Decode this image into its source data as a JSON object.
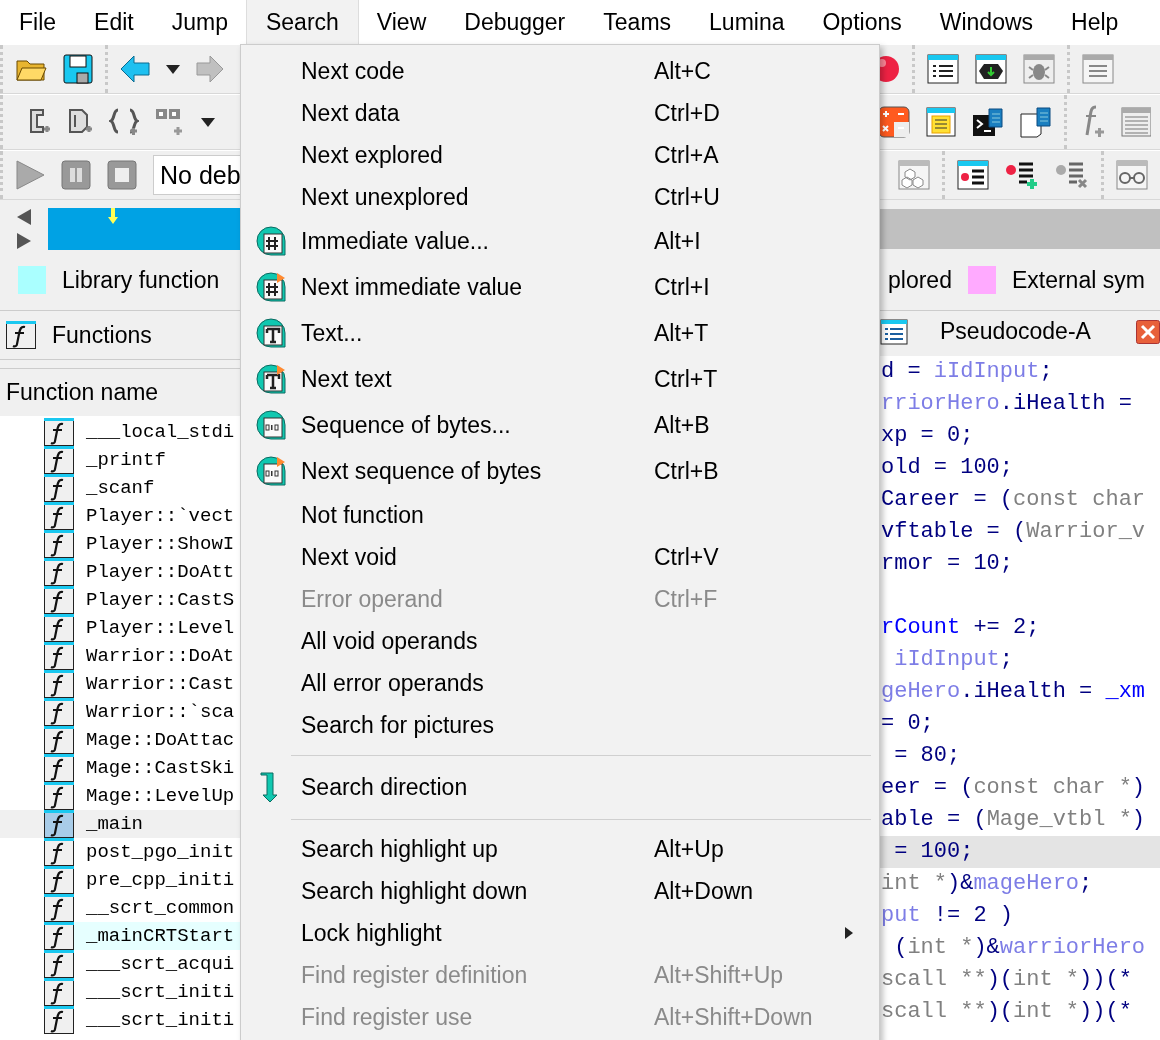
{
  "menubar": [
    {
      "label": "File",
      "selected": false
    },
    {
      "label": "Edit",
      "selected": false
    },
    {
      "label": "Jump",
      "selected": false
    },
    {
      "label": "Search",
      "selected": true
    },
    {
      "label": "View",
      "selected": false
    },
    {
      "label": "Debugger",
      "selected": false
    },
    {
      "label": "Teams",
      "selected": false
    },
    {
      "label": "Lumina",
      "selected": false
    },
    {
      "label": "Options",
      "selected": false
    },
    {
      "label": "Windows",
      "selected": false
    },
    {
      "label": "Help",
      "selected": false
    }
  ],
  "debugger_field": {
    "value": "No deb"
  },
  "legend": [
    {
      "label": "Library function",
      "color": "#aaffff"
    },
    {
      "label": "plored"
    },
    {
      "label": "External sym",
      "color": "#ffaaff"
    }
  ],
  "functions_pane": {
    "title": "Functions",
    "column": "Function name",
    "rows": [
      {
        "name": "___local_stdi",
        "selected": false,
        "kind": "regular"
      },
      {
        "name": "_printf",
        "selected": false,
        "kind": "regular"
      },
      {
        "name": "_scanf",
        "selected": false,
        "kind": "regular"
      },
      {
        "name": "Player::`vect",
        "selected": false,
        "kind": "regular"
      },
      {
        "name": "Player::ShowI",
        "selected": false,
        "kind": "regular"
      },
      {
        "name": "Player::DoAtt",
        "selected": false,
        "kind": "regular"
      },
      {
        "name": "Player::CastS",
        "selected": false,
        "kind": "regular"
      },
      {
        "name": "Player::Level",
        "selected": false,
        "kind": "regular"
      },
      {
        "name": "Warrior::DoAt",
        "selected": false,
        "kind": "regular"
      },
      {
        "name": "Warrior::Cast",
        "selected": false,
        "kind": "regular"
      },
      {
        "name": "Warrior::`sca",
        "selected": false,
        "kind": "regular"
      },
      {
        "name": "Mage::DoAttac",
        "selected": false,
        "kind": "regular"
      },
      {
        "name": "Mage::CastSki",
        "selected": false,
        "kind": "regular"
      },
      {
        "name": "Mage::LevelUp",
        "selected": false,
        "kind": "regular"
      },
      {
        "name": "_main",
        "selected": true,
        "kind": "regular"
      },
      {
        "name": "post_pgo_init",
        "selected": false,
        "kind": "regular"
      },
      {
        "name": "pre_cpp_initi",
        "selected": false,
        "kind": "regular"
      },
      {
        "name": "__scrt_common",
        "selected": false,
        "kind": "regular"
      },
      {
        "name": "_mainCRTStart",
        "selected": false,
        "kind": "library"
      },
      {
        "name": "___scrt_acqui",
        "selected": false,
        "kind": "regular"
      },
      {
        "name": "___scrt_initi",
        "selected": false,
        "kind": "regular"
      },
      {
        "name": "___scrt_initi",
        "selected": false,
        "kind": "regular"
      }
    ]
  },
  "pseudocode_pane": {
    "title": "Pseudocode-A",
    "lines": [
      {
        "selected": false,
        "segments": [
          {
            "text": "d = ",
            "kind": "plain"
          },
          {
            "text": "iIdInput",
            "kind": "var"
          },
          {
            "text": ";",
            "kind": "plain"
          }
        ]
      },
      {
        "selected": false,
        "segments": [
          {
            "text": "rriorHero",
            "kind": "var"
          },
          {
            "text": ".iHealth =",
            "kind": "plain"
          }
        ]
      },
      {
        "selected": false,
        "segments": [
          {
            "text": "xp = 0;",
            "kind": "plain"
          }
        ]
      },
      {
        "selected": false,
        "segments": [
          {
            "text": "old = 100;",
            "kind": "plain"
          }
        ]
      },
      {
        "selected": false,
        "segments": [
          {
            "text": "Career = (",
            "kind": "plain"
          },
          {
            "text": "const char",
            "kind": "type"
          }
        ]
      },
      {
        "selected": false,
        "segments": [
          {
            "text": "vftable = (",
            "kind": "plain"
          },
          {
            "text": "Warrior_v",
            "kind": "type"
          }
        ]
      },
      {
        "selected": false,
        "segments": [
          {
            "text": "rmor = 10;",
            "kind": "plain"
          }
        ]
      },
      {
        "selected": false
      },
      {
        "selected": false,
        "segments": [
          {
            "text": "rCount",
            "kind": "global"
          },
          {
            "text": " += 2;",
            "kind": "plain"
          }
        ]
      },
      {
        "selected": false,
        "segments": [
          {
            "text": " iIdInput",
            "kind": "var"
          },
          {
            "text": ";",
            "kind": "plain"
          }
        ]
      },
      {
        "selected": false,
        "segments": [
          {
            "text": "geHero",
            "kind": "var"
          },
          {
            "text": ".iHealth = ",
            "kind": "plain"
          },
          {
            "text": "_xm",
            "kind": "global"
          }
        ]
      },
      {
        "selected": false,
        "segments": [
          {
            "text": "= 0;",
            "kind": "plain"
          }
        ]
      },
      {
        "selected": false,
        "segments": [
          {
            "text": " = 80;",
            "kind": "plain"
          }
        ]
      },
      {
        "selected": false,
        "segments": [
          {
            "text": "eer = (",
            "kind": "plain"
          },
          {
            "text": "const char *",
            "kind": "type"
          },
          {
            "text": ")",
            "kind": "plain"
          }
        ]
      },
      {
        "selected": false,
        "segments": [
          {
            "text": "able = (",
            "kind": "plain"
          },
          {
            "text": "Mage_vtbl *",
            "kind": "type"
          },
          {
            "text": ")",
            "kind": "plain"
          }
        ]
      },
      {
        "selected": true,
        "segments": [
          {
            "text": " = 100;",
            "kind": "plain"
          }
        ]
      },
      {
        "selected": false,
        "segments": [
          {
            "text": "int *",
            "kind": "type"
          },
          {
            "text": ")&",
            "kind": "plain"
          },
          {
            "text": "mageHero",
            "kind": "var"
          },
          {
            "text": ";",
            "kind": "plain"
          }
        ]
      },
      {
        "selected": false,
        "segments": [
          {
            "text": "put",
            "kind": "var"
          },
          {
            "text": " != 2 )",
            "kind": "plain"
          }
        ]
      },
      {
        "selected": false,
        "segments": [
          {
            "text": " (",
            "kind": "plain"
          },
          {
            "text": "int *",
            "kind": "type"
          },
          {
            "text": ")&",
            "kind": "plain"
          },
          {
            "text": "warriorHero",
            "kind": "var"
          }
        ]
      },
      {
        "selected": false,
        "segments": [
          {
            "text": "scall **",
            "kind": "type"
          },
          {
            "text": ")(",
            "kind": "plain"
          },
          {
            "text": "int *",
            "kind": "type"
          },
          {
            "text": "))(*",
            "kind": "plain"
          }
        ]
      },
      {
        "selected": false,
        "segments": [
          {
            "text": "scall **",
            "kind": "type"
          },
          {
            "text": ")(",
            "kind": "plain"
          },
          {
            "text": "int *",
            "kind": "type"
          },
          {
            "text": "))(*",
            "kind": "plain"
          }
        ]
      }
    ]
  },
  "search_menu": {
    "items": [
      {
        "kind": "item",
        "label": "Next code",
        "shortcut": "Alt+C",
        "disabled": false,
        "submenu": false
      },
      {
        "kind": "item",
        "label": "Next data",
        "shortcut": "Ctrl+D",
        "disabled": false,
        "submenu": false
      },
      {
        "kind": "item",
        "label": "Next explored",
        "shortcut": "Ctrl+A",
        "disabled": false,
        "submenu": false
      },
      {
        "kind": "item",
        "label": "Next unexplored",
        "shortcut": "Ctrl+U",
        "disabled": false,
        "submenu": false
      },
      {
        "kind": "item",
        "label": "Immediate value...",
        "shortcut": "Alt+I",
        "disabled": false,
        "submenu": false
      },
      {
        "kind": "item",
        "label": "Next immediate value",
        "shortcut": "Ctrl+I",
        "disabled": false,
        "submenu": false
      },
      {
        "kind": "item",
        "label": "Text...",
        "shortcut": "Alt+T",
        "disabled": false,
        "submenu": false
      },
      {
        "kind": "item",
        "label": "Next text",
        "shortcut": "Ctrl+T",
        "disabled": false,
        "submenu": false
      },
      {
        "kind": "item",
        "label": "Sequence of bytes...",
        "shortcut": "Alt+B",
        "disabled": false,
        "submenu": false
      },
      {
        "kind": "item",
        "label": "Next sequence of bytes",
        "shortcut": "Ctrl+B",
        "disabled": false,
        "submenu": false
      },
      {
        "kind": "item",
        "label": "Not function",
        "disabled": false,
        "submenu": false
      },
      {
        "kind": "item",
        "label": "Next void",
        "shortcut": "Ctrl+V",
        "disabled": false,
        "submenu": false
      },
      {
        "kind": "item",
        "label": "Error operand",
        "shortcut": "Ctrl+F",
        "disabled": true,
        "submenu": false
      },
      {
        "kind": "item",
        "label": "All void operands",
        "disabled": false,
        "submenu": false
      },
      {
        "kind": "item",
        "label": "All error operands",
        "disabled": false,
        "submenu": false
      },
      {
        "kind": "item",
        "label": "Search for pictures",
        "disabled": false,
        "submenu": false
      },
      {
        "kind": "separator"
      },
      {
        "kind": "item",
        "label": "Search direction",
        "disabled": false,
        "submenu": false
      },
      {
        "kind": "separator"
      },
      {
        "kind": "item",
        "label": "Search highlight up",
        "shortcut": "Alt+Up",
        "disabled": false,
        "submenu": false
      },
      {
        "kind": "item",
        "label": "Search highlight down",
        "shortcut": "Alt+Down",
        "disabled": false,
        "submenu": false
      },
      {
        "kind": "item",
        "label": "Lock highlight",
        "disabled": false,
        "submenu": true
      },
      {
        "kind": "item",
        "label": "Find register definition",
        "shortcut": "Alt+Shift+Up",
        "disabled": true,
        "submenu": false
      },
      {
        "kind": "item",
        "label": "Find register use",
        "shortcut": "Alt+Shift+Down",
        "disabled": true,
        "submenu": false
      }
    ]
  }
}
